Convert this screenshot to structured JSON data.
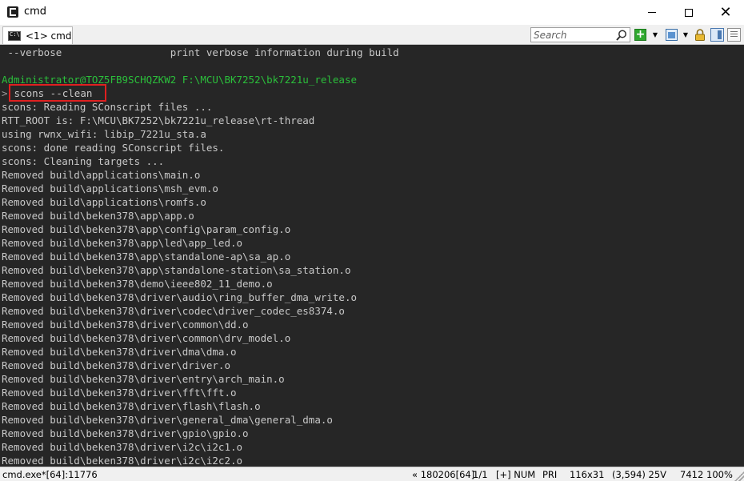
{
  "window": {
    "title": "cmd"
  },
  "toolbar": {
    "tab_label": "<1> cmd",
    "search_placeholder": "Search"
  },
  "console": {
    "lines": [
      {
        "text": " --verbose                  print verbose information during build",
        "kind": "output"
      },
      {
        "text": "",
        "kind": "output"
      },
      {
        "text": "Administrator@TOZ5FB9SCHQZKW2 F:\\MCU\\BK7252\\bk7221u_release",
        "kind": "prompt"
      },
      {
        "text": "scons --clean",
        "kind": "command",
        "arrow": ">"
      },
      {
        "text": "scons: Reading SConscript files ...",
        "kind": "output"
      },
      {
        "text": "RTT_ROOT is: F:\\MCU\\BK7252\\bk7221u_release\\rt-thread",
        "kind": "output"
      },
      {
        "text": "using rwnx_wifi: libip_7221u_sta.a",
        "kind": "output"
      },
      {
        "text": "scons: done reading SConscript files.",
        "kind": "output"
      },
      {
        "text": "scons: Cleaning targets ...",
        "kind": "output"
      },
      {
        "text": "Removed build\\applications\\main.o",
        "kind": "output"
      },
      {
        "text": "Removed build\\applications\\msh_evm.o",
        "kind": "output"
      },
      {
        "text": "Removed build\\applications\\romfs.o",
        "kind": "output"
      },
      {
        "text": "Removed build\\beken378\\app\\app.o",
        "kind": "output"
      },
      {
        "text": "Removed build\\beken378\\app\\config\\param_config.o",
        "kind": "output"
      },
      {
        "text": "Removed build\\beken378\\app\\led\\app_led.o",
        "kind": "output"
      },
      {
        "text": "Removed build\\beken378\\app\\standalone-ap\\sa_ap.o",
        "kind": "output"
      },
      {
        "text": "Removed build\\beken378\\app\\standalone-station\\sa_station.o",
        "kind": "output"
      },
      {
        "text": "Removed build\\beken378\\demo\\ieee802_11_demo.o",
        "kind": "output"
      },
      {
        "text": "Removed build\\beken378\\driver\\audio\\ring_buffer_dma_write.o",
        "kind": "output"
      },
      {
        "text": "Removed build\\beken378\\driver\\codec\\driver_codec_es8374.o",
        "kind": "output"
      },
      {
        "text": "Removed build\\beken378\\driver\\common\\dd.o",
        "kind": "output"
      },
      {
        "text": "Removed build\\beken378\\driver\\common\\drv_model.o",
        "kind": "output"
      },
      {
        "text": "Removed build\\beken378\\driver\\dma\\dma.o",
        "kind": "output"
      },
      {
        "text": "Removed build\\beken378\\driver\\driver.o",
        "kind": "output"
      },
      {
        "text": "Removed build\\beken378\\driver\\entry\\arch_main.o",
        "kind": "output"
      },
      {
        "text": "Removed build\\beken378\\driver\\fft\\fft.o",
        "kind": "output"
      },
      {
        "text": "Removed build\\beken378\\driver\\flash\\flash.o",
        "kind": "output"
      },
      {
        "text": "Removed build\\beken378\\driver\\general_dma\\general_dma.o",
        "kind": "output"
      },
      {
        "text": "Removed build\\beken378\\driver\\gpio\\gpio.o",
        "kind": "output"
      },
      {
        "text": "Removed build\\beken378\\driver\\i2c\\i2c1.o",
        "kind": "output"
      },
      {
        "text": "Removed build\\beken378\\driver\\i2c\\i2c2.o",
        "kind": "output"
      }
    ]
  },
  "statusbar": {
    "process": "cmd.exe*[64]:11776",
    "pid": "« 180206[64]",
    "page": "1/1",
    "flags": "[+] NUM",
    "pri": "PRI ",
    "size": "116x31",
    "cursor": "(3,594) 25V",
    "num": "7412",
    "zoom": "100%"
  },
  "colors": {
    "console_bg": "#262626",
    "console_fg": "#c8c8c8",
    "prompt_green": "#2bbf3b",
    "highlight_red": "#e02020"
  }
}
